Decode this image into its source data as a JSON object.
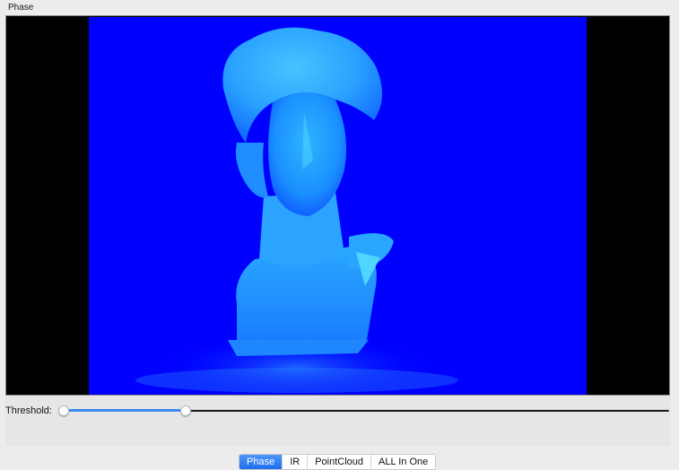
{
  "window": {
    "title": "Phase"
  },
  "controls": {
    "threshold_label": "Threshold:",
    "threshold_min_value": 0.0,
    "threshold_max_value": 0.2
  },
  "tabs": [
    {
      "label": "Phase",
      "active": true
    },
    {
      "label": "IR",
      "active": false
    },
    {
      "label": "PointCloud",
      "active": false
    },
    {
      "label": "ALL In One",
      "active": false
    }
  ],
  "colors": {
    "background_blue": "#0000ff",
    "bust_cyan": "#35b0ff",
    "accent": "#3d8bf2"
  }
}
